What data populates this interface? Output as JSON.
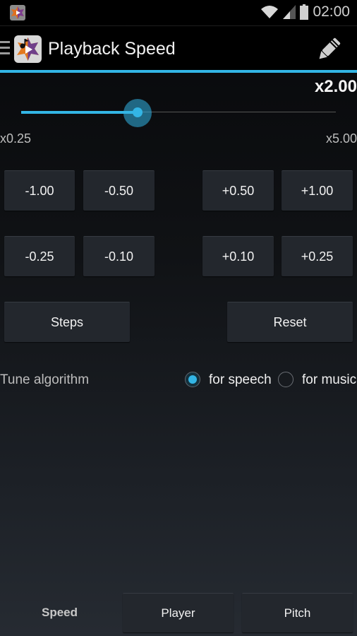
{
  "status_bar": {
    "app_icon": "playback-speed-app-icon",
    "icons": [
      "wifi-icon",
      "cell-signal-icon",
      "battery-icon"
    ],
    "time": "02:00"
  },
  "action_bar": {
    "menu_icon": "hamburger-menu-icon",
    "app_icon": "maple-leaf-music-play-icon",
    "title": "Playback Speed",
    "edit_icon": "pencil-icon",
    "accent_color": "#33b5e5"
  },
  "speed": {
    "current_label": "x2.00",
    "current_value": 2.0,
    "min_label": "x0.25",
    "max_label": "x5.00",
    "min": 0.25,
    "max": 5.0,
    "slider_fraction": 0.37
  },
  "step_buttons": {
    "row1": [
      "-1.00",
      "-0.50",
      "+0.50",
      "+1.00"
    ],
    "row2": [
      "-0.25",
      "-0.10",
      "+0.10",
      "+0.25"
    ]
  },
  "actions": {
    "steps": "Steps",
    "reset": "Reset"
  },
  "tune": {
    "label": "Tune algorithm",
    "options": [
      {
        "label": "for speech",
        "selected": true
      },
      {
        "label": "for music",
        "selected": false
      }
    ]
  },
  "bottom_tabs": [
    {
      "label": "Speed",
      "active": true
    },
    {
      "label": "Player",
      "active": false
    },
    {
      "label": "Pitch",
      "active": false
    }
  ]
}
